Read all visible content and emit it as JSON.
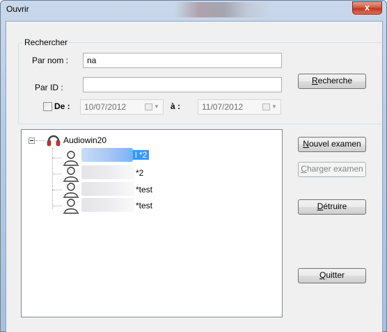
{
  "window": {
    "title": "Ouvrir",
    "close_glyph": "x"
  },
  "search": {
    "group_label": "Rechercher",
    "name_label": "Par nom :",
    "name_value": "na",
    "id_label": "Par ID :",
    "id_value": "",
    "date_from_label": "De :",
    "date_from": "10/07/2012",
    "date_to_label": "à :",
    "date_to": "11/07/2012"
  },
  "buttons": {
    "search_first": "R",
    "search_rest": "echerche",
    "new_exam_first": "N",
    "new_exam_rest": "ouvel examen",
    "load_exam_first": "C",
    "load_exam_rest": "harger examen",
    "delete_first": "D",
    "delete_rest": "étruire",
    "quit_first": "Q",
    "quit_rest": "uitter"
  },
  "tree": {
    "root": "Audiowin20",
    "items": [
      {
        "suffix": "l *2"
      },
      {
        "suffix": "*2"
      },
      {
        "suffix": "*test"
      },
      {
        "suffix": "*test"
      }
    ]
  }
}
